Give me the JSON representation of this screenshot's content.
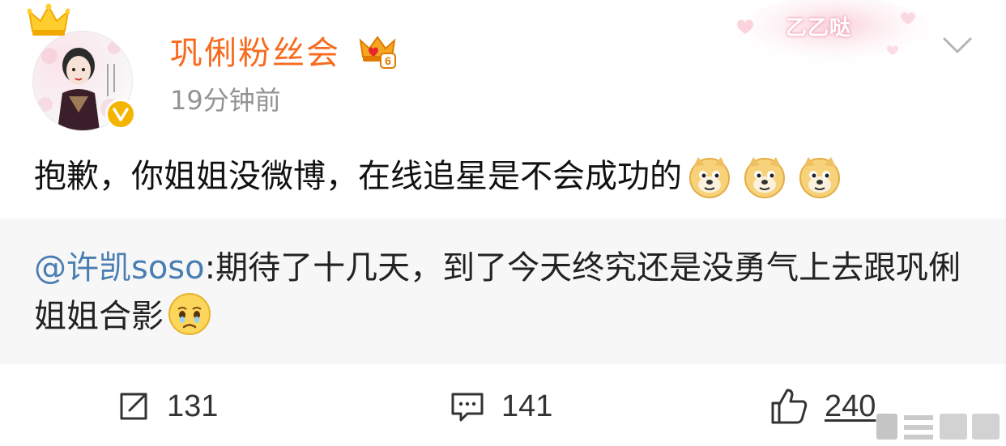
{
  "post": {
    "author": "巩俐粉丝会",
    "time": "19分钟前",
    "decoration_text": "乙乙哒",
    "text": "抱歉，你姐姐没微博，在线追星是不会成功的",
    "emojis": [
      "doge-emoji",
      "doge-emoji",
      "doge-emoji"
    ]
  },
  "quote": {
    "mention": "@许凯soso",
    "text": ":期待了十几天，到了今天终究还是没勇气上去跟巩俐姐姐合影",
    "emoji": "sad-emoji"
  },
  "actions": {
    "repost_count": "131",
    "comment_count": "141",
    "like_count": "240"
  },
  "icons": {
    "crown": "crown-icon",
    "vip": "vip-crown-icon",
    "verified": "verified-icon",
    "more": "chevron-down-icon",
    "repost": "repost-icon",
    "comment": "comment-icon",
    "like": "thumbs-up-icon"
  },
  "colors": {
    "author": "#f86b1f",
    "mention": "#4a7eb3",
    "time": "#939393",
    "quote_bg": "#f7f7f7",
    "verified": "#f4b400"
  }
}
